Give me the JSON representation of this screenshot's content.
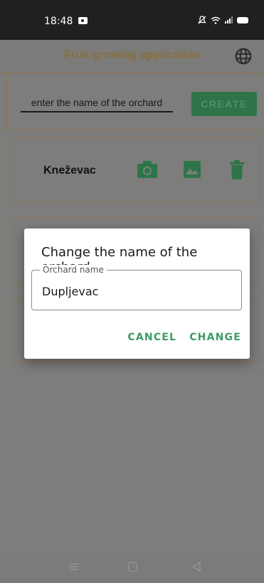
{
  "status_bar": {
    "time": "18:48"
  },
  "app_bar": {
    "title": "Fruit growing application"
  },
  "create": {
    "placeholder": "enter the name of the orchard",
    "button_label": "CREATE"
  },
  "orchards": [
    {
      "name": "Kneževac"
    },
    {
      "name": ""
    },
    {
      "name": ""
    }
  ],
  "dialog": {
    "title": "Change the name of the orchard",
    "field_label": "Orchard name",
    "field_value": "Dupljevac",
    "cancel_label": "CANCEL",
    "change_label": "CHANGE"
  },
  "colors": {
    "accent": "#3e9a66",
    "primary_button": "#2d7548",
    "title_color": "#8b6d3f"
  }
}
